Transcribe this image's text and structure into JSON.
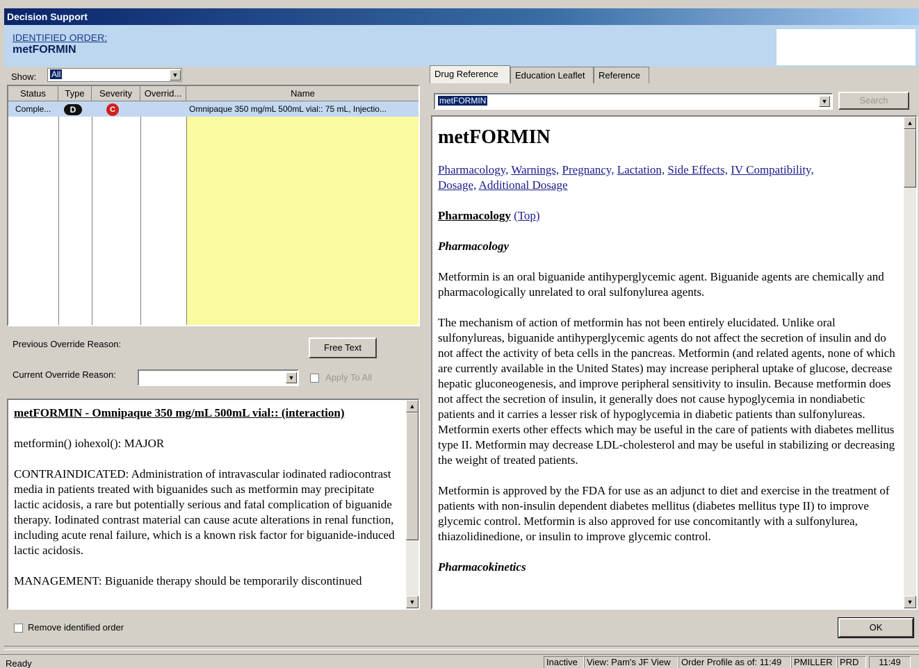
{
  "window": {
    "title": "Decision Support"
  },
  "order": {
    "label": "IDENTIFIED ORDER:",
    "name": "metFORMIN"
  },
  "left": {
    "show_label": "Show:",
    "show_value": "All",
    "columns": [
      "Status",
      "Type",
      "Severity",
      "Overrid...",
      "Name"
    ],
    "row": {
      "status": "Comple...",
      "type": "D",
      "severity": "C",
      "override": "",
      "name": "Omnipaque 350 mg/mL 500mL vial:: 75 mL, Injectio..."
    },
    "prev_override_label": "Previous Override Reason:",
    "free_text_button": "Free Text",
    "curr_override_label": "Current Override Reason:",
    "apply_to_all": "Apply To All",
    "interaction": {
      "title": "metFORMIN - Omnipaque 350 mg/mL 500mL vial:: (interaction)",
      "line1": "metformin() iohexol(): MAJOR",
      "para": "CONTRAINDICATED: Administration of intravascular iodinated radiocontrast media in patients treated with biguanides such as metformin may precipitate lactic acidosis, a rare but potentially serious and fatal complication of biguanide therapy. Iodinated contrast material can cause acute alterations in renal function, including acute renal failure, which is a known risk factor for biguanide-induced lactic acidosis.",
      "para2": "MANAGEMENT: Biguanide therapy should be temporarily discontinued"
    },
    "remove_label": "Remove identified order"
  },
  "right": {
    "tabs": [
      "Drug Reference",
      "Education Leaflet",
      "Reference"
    ],
    "search_value": "metFORMIN",
    "search_button": "Search",
    "drug_title": "metFORMIN",
    "links_line1": [
      "Pharmacology,",
      "Warnings,",
      "Pregnancy,",
      "Lactation,",
      "Side Effects,",
      "IV Compatibility,"
    ],
    "links_line2": [
      "Dosage,",
      "Additional Dosage"
    ],
    "section_title": "Pharmacology",
    "top_link": "(Top)",
    "subsection": "Pharmacology",
    "p1": "Metformin is an oral biguanide antihyperglycemic agent. Biguanide agents are chemically and pharmacologically unrelated to oral sulfonylurea agents.",
    "p2": "The mechanism of action of metformin has not been entirely elucidated. Unlike oral sulfonylureas, biguanide antihyperglycemic agents do not affect the secretion of insulin and do not affect the activity of beta cells in the pancreas. Metformin (and related agents, none of which are currently available in the United States) may increase peripheral uptake of glucose, decrease hepatic gluconeogenesis, and improve peripheral sensitivity to insulin. Because metformin does not affect the secretion of insulin, it generally does not cause hypoglycemia in nondiabetic patients and it carries a lesser risk of hypoglycemia in diabetic patients than sulfonylureas. Metformin exerts other effects which may be useful in the care of patients with diabetes mellitus type II. Metformin may decrease LDL-cholesterol and may be useful in stabilizing or decreasing the weight of treated patients.",
    "p3": "Metformin is approved by the FDA for use as an adjunct to diet and exercise in the treatment of patients with non-insulin dependent diabetes mellitus (diabetes mellitus type II) to improve glycemic control. Metformin is also approved for use concomitantly with a sulfonylurea, thiazolidinedione, or insulin to improve glycemic control.",
    "subsection2": "Pharmacokinetics"
  },
  "ok_button": "OK",
  "status": {
    "text": "Ready",
    "cells": [
      "Inactive",
      "View: Pam's JF View",
      "Order Profile as of: 11:49",
      "PMILLER",
      "PRD",
      "11:49"
    ]
  }
}
